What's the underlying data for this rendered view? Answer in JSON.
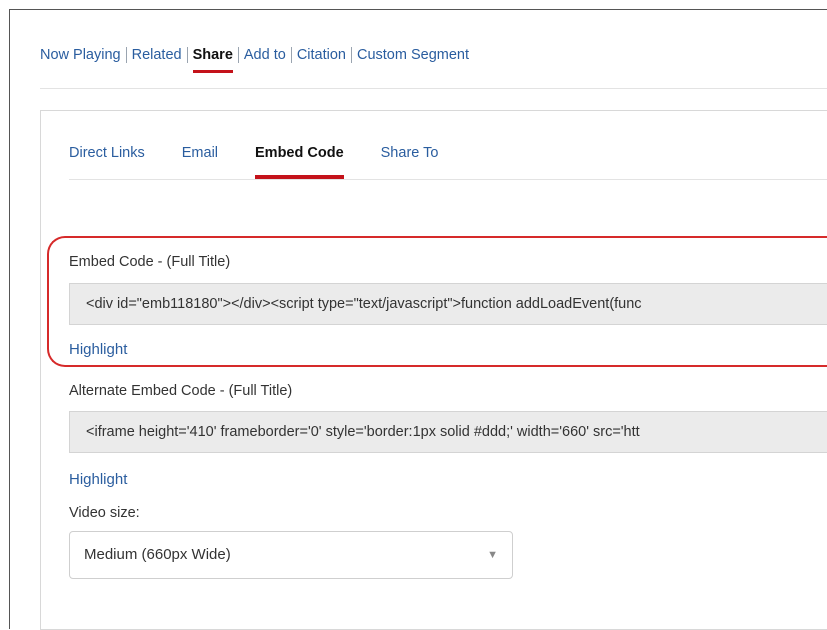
{
  "top_tabs": [
    {
      "label": "Now Playing"
    },
    {
      "label": "Related"
    },
    {
      "label": "Share"
    },
    {
      "label": "Add to"
    },
    {
      "label": "Citation"
    },
    {
      "label": "Custom Segment"
    }
  ],
  "sub_tabs": [
    {
      "label": "Direct Links"
    },
    {
      "label": "Email"
    },
    {
      "label": "Embed Code"
    },
    {
      "label": "Share To"
    }
  ],
  "embed": {
    "label": "Embed Code - (Full Title)",
    "code": "<div id=\"emb118180\"></div><script type=\"text/javascript\">function addLoadEvent(func",
    "highlight_label": "Highlight"
  },
  "alt_embed": {
    "label": "Alternate Embed Code - (Full Title)",
    "code": "<iframe height='410' frameborder='0' style='border:1px solid #ddd;' width='660' src='htt",
    "highlight_label": "Highlight"
  },
  "video_size": {
    "label": "Video size:",
    "selected": "Medium (660px Wide)"
  }
}
